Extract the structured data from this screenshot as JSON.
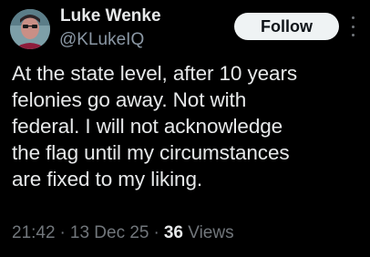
{
  "author": {
    "display_name": "Luke Wenke",
    "handle": "@KLukeIQ"
  },
  "actions": {
    "follow_label": "Follow",
    "more_icon": "more-vertical-icon"
  },
  "tweet": {
    "text": "At the state level, after 10 years\nfelonies go away.  Not with\nfederal.  I will not acknowledge\nthe flag until my circumstances\nare fixed to my liking.",
    "time": "21:42",
    "date": "13 Dec 25",
    "separator": "·",
    "views_count": "36",
    "views_label": "Views"
  },
  "colors": {
    "background": "#000000",
    "primary_text": "#e7e9ea",
    "secondary_text": "#71767b",
    "follow_button_bg": "#eff3f4"
  }
}
